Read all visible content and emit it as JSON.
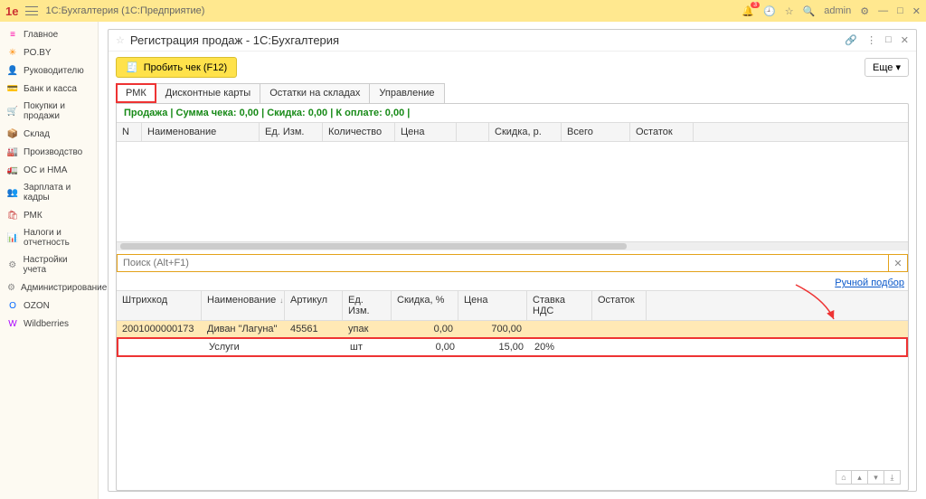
{
  "topbar": {
    "logo": "1e",
    "title": "1С:Бухгалтерия  (1С:Предприятие)",
    "badge": "3",
    "user": "admin"
  },
  "sidebar": {
    "items": [
      {
        "icon": "≡",
        "label": "Главное",
        "color": "#f0a"
      },
      {
        "icon": "✳",
        "label": "PO.BY",
        "color": "#f80"
      },
      {
        "icon": "👤",
        "label": "Руководителю",
        "color": "#888"
      },
      {
        "icon": "💳",
        "label": "Банк и касса",
        "color": "#4a4"
      },
      {
        "icon": "🛒",
        "label": "Покупки и продажи",
        "color": "#b55"
      },
      {
        "icon": "📦",
        "label": "Склад",
        "color": "#c84"
      },
      {
        "icon": "🏭",
        "label": "Производство",
        "color": "#a33"
      },
      {
        "icon": "🚛",
        "label": "ОС и НМА",
        "color": "#c55"
      },
      {
        "icon": "👥",
        "label": "Зарплата и кадры",
        "color": "#4a4"
      },
      {
        "icon": "🛍",
        "label": "РМК",
        "color": "#c44"
      },
      {
        "icon": "📊",
        "label": "Налоги и отчетность",
        "color": "#888"
      },
      {
        "icon": "⚙",
        "label": "Настройки учета",
        "color": "#888"
      },
      {
        "icon": "⚙",
        "label": "Администрирование",
        "color": "#888"
      },
      {
        "icon": "O",
        "label": "OZON",
        "color": "#06f"
      },
      {
        "icon": "W",
        "label": "Wildberries",
        "color": "#a0f"
      }
    ]
  },
  "window": {
    "title": "Регистрация продаж - 1С:Бухгалтерия",
    "punch_label": "Пробить чек (F12)",
    "more_label": "Еще"
  },
  "tabs": [
    {
      "label": "РМК",
      "active": true
    },
    {
      "label": "Дисконтные карты"
    },
    {
      "label": "Остатки на складах"
    },
    {
      "label": "Управление"
    }
  ],
  "summary": "Продажа | Сумма чека: 0,00 | Скидка: 0,00 | К оплате: 0,00 |",
  "grid1_headers": [
    "N",
    "Наименование",
    "Ед. Изм.",
    "Количество",
    "Цена",
    "",
    "Скидка, р.",
    "Всего",
    "Остаток"
  ],
  "search_placeholder": "Поиск (Alt+F1)",
  "manual_link": "Ручной подбор",
  "grid2_headers": [
    "Штрихкод",
    "Наименование",
    "Артикул",
    "Ед. Изм.",
    "Скидка, %",
    "Цена",
    "Ставка НДС",
    "Остаток"
  ],
  "grid2_rows": [
    {
      "barcode": "2001000000173",
      "name": "Диван \"Лагуна\"",
      "article": "45561",
      "unit": "упак",
      "discount": "0,00",
      "price": "700,00",
      "vat": "",
      "stock": ""
    },
    {
      "barcode": "",
      "name": "Услуги",
      "article": "",
      "unit": "шт",
      "discount": "0,00",
      "price": "15,00",
      "vat": "20%",
      "stock": ""
    }
  ]
}
